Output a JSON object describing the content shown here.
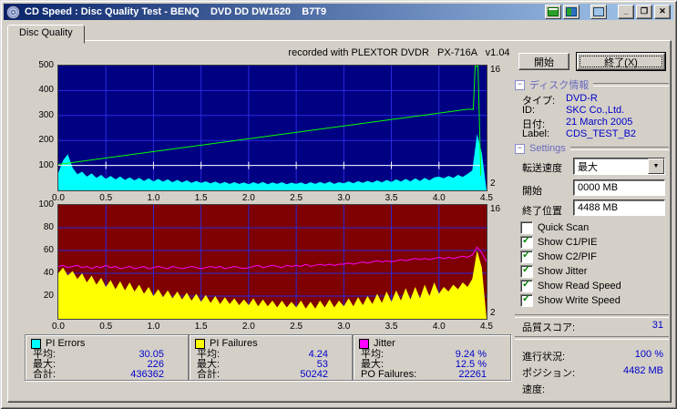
{
  "window": {
    "title": "CD Speed : Disc Quality Test - BENQ    DVD DD DW1620    B7T9",
    "tab": "Disc Quality"
  },
  "chart_header": "recorded with PLEXTOR DVDR   PX-716A   v1.04",
  "icons": {
    "minimize": "_",
    "maximize": "❐",
    "close": "✕",
    "dropdown": "▼",
    "collapse": "−",
    "check": "✓"
  },
  "buttons": {
    "start": "開始",
    "exit": "終了(X)"
  },
  "disc_info": {
    "title": "ディスク情報",
    "rows": [
      {
        "label": "タイプ:",
        "value": "DVD-R"
      },
      {
        "label": "ID:",
        "value": "SKC Co.,Ltd."
      },
      {
        "label": "日付:",
        "value": "21 March 2005"
      },
      {
        "label": "Label:",
        "value": "CDS_TEST_B2"
      }
    ]
  },
  "settings": {
    "title": "Settings",
    "speed_label": "転送速度",
    "speed_value": "最大",
    "start_label": "開始",
    "start_value": "0000 MB",
    "end_label": "終了位置",
    "end_value": "4488 MB",
    "checkboxes": [
      {
        "label": "Quick Scan",
        "checked": false
      },
      {
        "label": "Show C1/PIE",
        "checked": true
      },
      {
        "label": "Show C2/PIF",
        "checked": true
      },
      {
        "label": "Show Jitter",
        "checked": true
      },
      {
        "label": "Show Read Speed",
        "checked": true
      },
      {
        "label": "Show Write Speed",
        "checked": true
      }
    ]
  },
  "quality": {
    "label": "品質スコア:",
    "value": "31"
  },
  "status": {
    "rows": [
      {
        "label": "進行状況:",
        "value": "100 %"
      },
      {
        "label": "ポジション:",
        "value": "4482 MB"
      },
      {
        "label": "速度:",
        "value": ""
      }
    ]
  },
  "stats": [
    {
      "name": "PI Errors",
      "color": "#00FFFF",
      "rows": [
        [
          "平均:",
          "30.05"
        ],
        [
          "最大:",
          "226"
        ],
        [
          "合計:",
          "436362"
        ]
      ]
    },
    {
      "name": "PI Failures",
      "color": "#FFFF00",
      "rows": [
        [
          "平均:",
          "4.24"
        ],
        [
          "最大:",
          "53"
        ],
        [
          "合計:",
          "50242"
        ]
      ]
    },
    {
      "name": "Jitter",
      "color": "#FF00FF",
      "rows": [
        [
          "平均:",
          "9.24 %"
        ],
        [
          "最大:",
          "12.5 %"
        ],
        [
          "PO Failures:",
          "22261"
        ]
      ]
    }
  ],
  "chart_data": [
    {
      "type": "area",
      "title": "PI Errors / Read Speed / Write Speed",
      "bg": "#000082",
      "grid": "#2A2ADF",
      "xlim": [
        0,
        4.5
      ],
      "ylim": [
        0,
        500
      ],
      "x_ticks": [
        [
          0,
          "0.0"
        ],
        [
          0.5,
          "0.5"
        ],
        [
          1,
          "1.0"
        ],
        [
          1.5,
          "1.5"
        ],
        [
          2,
          "2.0"
        ],
        [
          2.5,
          "2.5"
        ],
        [
          3,
          "3.0"
        ],
        [
          3.5,
          "3.5"
        ],
        [
          4,
          "4.0"
        ],
        [
          4.5,
          "4.5"
        ]
      ],
      "y_ticks": [
        [
          100,
          "100"
        ],
        [
          200,
          "200"
        ],
        [
          300,
          "300"
        ],
        [
          400,
          "400"
        ],
        [
          500,
          "500"
        ]
      ],
      "right_ticks": [
        [
          0.96,
          "16"
        ],
        [
          0.05,
          "2"
        ]
      ],
      "series": [
        {
          "name": "PI Errors",
          "type": "area",
          "color": "#00FFFF",
          "x0": 0,
          "dx": 0.05,
          "values": [
            70,
            120,
            145,
            90,
            65,
            75,
            55,
            68,
            50,
            62,
            46,
            58,
            44,
            56,
            42,
            52,
            40,
            50,
            38,
            48,
            36,
            46,
            35,
            44,
            33,
            42,
            32,
            40,
            30,
            38,
            30,
            36,
            28,
            35,
            27,
            34,
            26,
            33,
            26,
            32,
            25,
            33,
            26,
            34,
            25,
            32,
            26,
            33,
            25,
            31,
            26,
            32,
            25,
            33,
            26,
            34,
            27,
            35,
            26,
            33,
            28,
            36,
            29,
            37,
            30,
            38,
            31,
            40,
            32,
            42,
            34,
            44,
            35,
            46,
            36,
            48,
            38,
            50,
            40,
            52,
            55,
            48,
            58,
            50,
            62,
            54,
            66,
            80,
            226,
            150,
            0
          ]
        },
        {
          "name": "Read Speed",
          "type": "line",
          "color": "#FFFFFF",
          "points": [
            [
              0,
              100
            ],
            [
              4.44,
              100
            ]
          ]
        },
        {
          "name": "Read Speed ticks",
          "type": "vticks",
          "color": "#FFFFFF",
          "y": 100,
          "half": 4,
          "xs": [
            0.5,
            1,
            1.5,
            2,
            2.5,
            3,
            3.5,
            4
          ]
        },
        {
          "name": "Write Speed",
          "type": "line",
          "color": "#00FF00",
          "points": [
            [
              0,
              104
            ],
            [
              4.32,
              326
            ],
            [
              4.36,
              324
            ],
            [
              4.38,
              498
            ],
            [
              4.41,
              498
            ],
            [
              4.43,
              200
            ],
            [
              4.44,
              60
            ]
          ]
        }
      ]
    },
    {
      "type": "area",
      "title": "PI Failures / Jitter",
      "bg": "#7E0000",
      "grid": "#2A2ADF",
      "xlim": [
        0,
        4.5
      ],
      "ylim": [
        0,
        100
      ],
      "x_ticks": [
        [
          0,
          "0.0"
        ],
        [
          0.5,
          "0.5"
        ],
        [
          1,
          "1.0"
        ],
        [
          1.5,
          "1.5"
        ],
        [
          2,
          "2.0"
        ],
        [
          2.5,
          "2.5"
        ],
        [
          3,
          "3.0"
        ],
        [
          3.5,
          "3.5"
        ],
        [
          4,
          "4.0"
        ],
        [
          4.5,
          "4.5"
        ]
      ],
      "y_ticks": [
        [
          20,
          "20"
        ],
        [
          40,
          "40"
        ],
        [
          60,
          "60"
        ],
        [
          80,
          "80"
        ],
        [
          100,
          "100"
        ]
      ],
      "right_ticks": [
        [
          0.96,
          "16"
        ],
        [
          0.05,
          "2"
        ]
      ],
      "series": [
        {
          "name": "PI Failures",
          "type": "area",
          "color": "#FFFF00",
          "x0": 0,
          "dx": 0.05,
          "values": [
            40,
            45,
            38,
            42,
            35,
            40,
            32,
            38,
            30,
            36,
            28,
            34,
            26,
            33,
            25,
            32,
            24,
            30,
            22,
            28,
            20,
            26,
            19,
            25,
            18,
            24,
            17,
            23,
            16,
            22,
            15,
            21,
            14,
            20,
            13,
            19,
            13,
            18,
            12,
            17,
            12,
            18,
            11,
            17,
            11,
            16,
            10,
            16,
            10,
            15,
            10,
            16,
            9,
            15,
            9,
            16,
            10,
            17,
            10,
            16,
            11,
            18,
            11,
            19,
            12,
            20,
            13,
            22,
            14,
            24,
            15,
            25,
            16,
            27,
            17,
            28,
            18,
            30,
            20,
            32,
            22,
            28,
            24,
            30,
            26,
            32,
            28,
            35,
            60,
            45,
            0
          ]
        },
        {
          "name": "Jitter",
          "type": "line",
          "color": "#FF00FF",
          "x0": 0,
          "dx": 0.05,
          "values": [
            46,
            47,
            45,
            46,
            47,
            45,
            46,
            44,
            46,
            45,
            47,
            45,
            46,
            44,
            45,
            46,
            44,
            45,
            46,
            44,
            45,
            46,
            45,
            44,
            46,
            45,
            44,
            45,
            46,
            45,
            44,
            45,
            46,
            45,
            46,
            44,
            45,
            46,
            45,
            44,
            45,
            46,
            47,
            45,
            46,
            47,
            46,
            45,
            47,
            46,
            47,
            46,
            48,
            46,
            47,
            48,
            47,
            48,
            47,
            48,
            48,
            49,
            48,
            49,
            50,
            49,
            50,
            51,
            50,
            51,
            50,
            51,
            52,
            51,
            52,
            53,
            52,
            53,
            52,
            53,
            54,
            53,
            54,
            53,
            54,
            55,
            54,
            56,
            63,
            58,
            50
          ]
        }
      ]
    }
  ]
}
